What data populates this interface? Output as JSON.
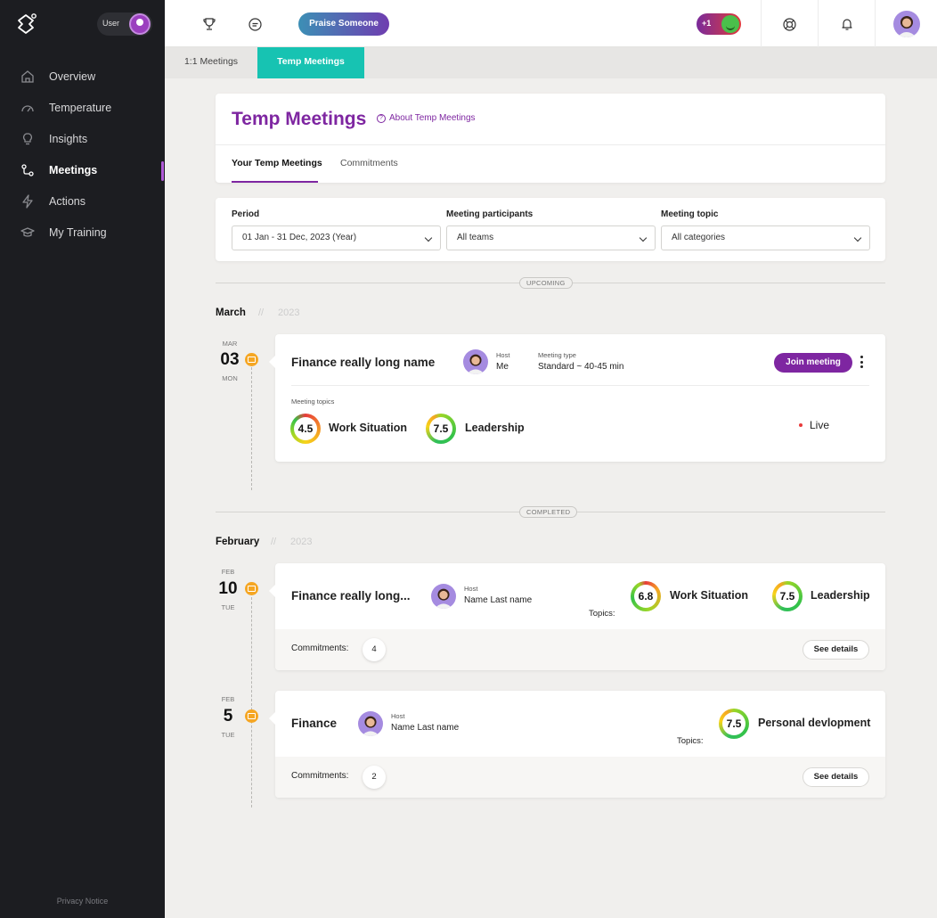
{
  "sidebar": {
    "user_label": "User",
    "items": [
      {
        "label": "Overview"
      },
      {
        "label": "Temperature"
      },
      {
        "label": "Insights"
      },
      {
        "label": "Meetings"
      },
      {
        "label": "Actions"
      },
      {
        "label": "My Training"
      }
    ],
    "active_item": "Meetings",
    "privacy": "Privacy Notice"
  },
  "topbar": {
    "praise_label": "Praise Someone",
    "plus_label": "+1"
  },
  "tabs": [
    {
      "label": "1:1 Meetings"
    },
    {
      "label": "Temp Meetings"
    }
  ],
  "header": {
    "title": "Temp Meetings",
    "about_link": "About Temp Meetings",
    "subtabs": [
      {
        "label": "Your Temp Meetings"
      },
      {
        "label": "Commitments"
      }
    ]
  },
  "filters": {
    "period": {
      "label": "Period",
      "value": "01 Jan - 31 Dec, 2023 (Year)"
    },
    "participants": {
      "label": "Meeting participants",
      "value": "All teams"
    },
    "topic": {
      "label": "Meeting topic",
      "value": "All categories"
    }
  },
  "upcoming": {
    "section_label": "UPCOMING",
    "month": "March",
    "year": "2023",
    "meeting": {
      "date_month": "MAR",
      "date_day": "03",
      "date_dow": "MON",
      "title": "Finance really long name",
      "host_label": "Host",
      "host_name": "Me",
      "type_label": "Meeting type",
      "type_value": "Standard ~ 40-45 min",
      "join_label": "Join meeting",
      "topics_label": "Meeting topics",
      "topics": [
        {
          "score": "4.5",
          "name": "Work Situation"
        },
        {
          "score": "7.5",
          "name": "Leadership"
        }
      ],
      "status": "Live"
    }
  },
  "completed": {
    "section_label": "COMPLETED",
    "month": "February",
    "year": "2023",
    "meetings": [
      {
        "date_month": "FEB",
        "date_day": "10",
        "date_dow": "TUE",
        "title": "Finance really long...",
        "host_label": "Host",
        "host_name": "Name Last name",
        "topics_label": "Topics:",
        "topics": [
          {
            "score": "6.8",
            "name": "Work Situation"
          },
          {
            "score": "7.5",
            "name": "Leadership"
          }
        ],
        "commitments_label": "Commitments:",
        "commitments_count": "4",
        "details_label": "See details"
      },
      {
        "date_month": "FEB",
        "date_day": "5",
        "date_dow": "TUE",
        "title": "Finance",
        "host_label": "Host",
        "host_name": "Name Last name",
        "topics_label": "Topics:",
        "topics": [
          {
            "score": "7.5",
            "name": "Personal devlopment"
          }
        ],
        "commitments_label": "Commitments:",
        "commitments_count": "2",
        "details_label": "See details"
      }
    ]
  },
  "colors": {
    "sidebar_bg": "#1c1d21",
    "accent_purple": "#7e26a1",
    "accent_teal": "#17c3b2",
    "badge_orange": "#f5a623",
    "page_bg": "#f0efed"
  },
  "icons": {
    "logo": "app-logo-icon",
    "nav": [
      "home-icon",
      "gauge-icon",
      "lightbulb-icon",
      "meetings-icon",
      "lightning-icon",
      "graduation-cap-icon"
    ],
    "topbar": [
      "trophy-icon",
      "chat-icon",
      "lifebuoy-icon",
      "bell-icon"
    ]
  }
}
